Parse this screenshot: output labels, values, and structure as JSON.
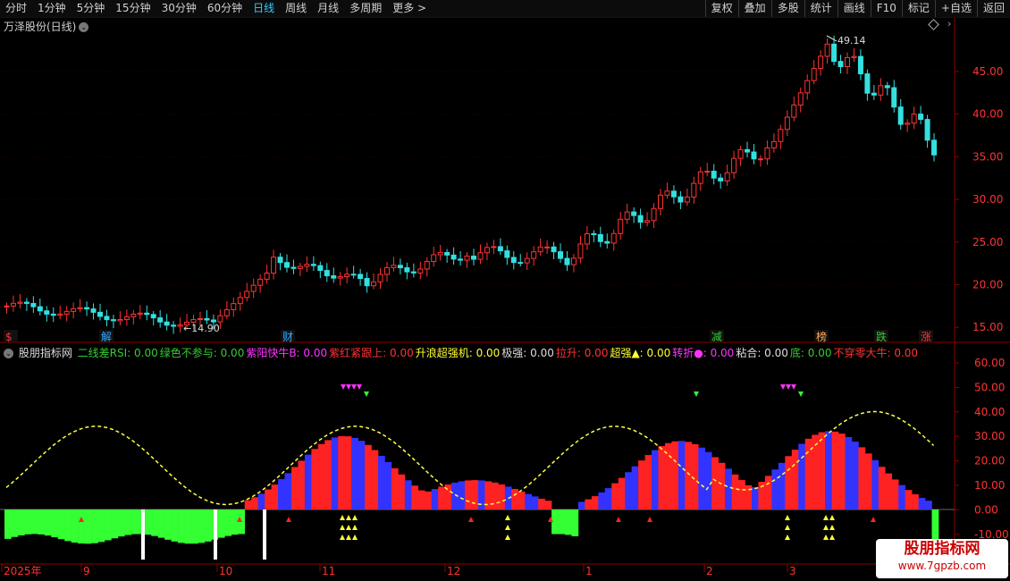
{
  "toolbar": {
    "tabs": [
      "分时",
      "1分钟",
      "5分钟",
      "15分钟",
      "30分钟",
      "60分钟",
      "日线",
      "周线",
      "月线",
      "多周期",
      "更多 >"
    ],
    "active_tab": "日线",
    "right_buttons": [
      "复权",
      "叠加",
      "多股",
      "统计",
      "画线",
      "F10",
      "标记",
      "+自选",
      "返回"
    ]
  },
  "stock": {
    "title": "万泽股份(日线)"
  },
  "price_axis": {
    "labels": [
      "45.00",
      "40.00",
      "35.00",
      "30.00",
      "25.00",
      "20.00",
      "15.00"
    ]
  },
  "annotations": {
    "high": "49.14",
    "low": "14.90"
  },
  "event_markers": [
    {
      "text": "$",
      "color": "#ff3333"
    },
    {
      "text": "解",
      "color": "#33aaff"
    },
    {
      "text": "财",
      "color": "#33aaff"
    },
    {
      "text": "减",
      "color": "#33cc33"
    },
    {
      "text": "榜",
      "color": "#ffaa55"
    },
    {
      "text": "跌",
      "color": "#33cc33"
    },
    {
      "text": "涨",
      "color": "#ff3333"
    }
  ],
  "indicator": {
    "name": "股朋指标网",
    "values": [
      {
        "label": "二线差RSI: 0.00",
        "color": "#33cc33"
      },
      {
        "label": "绿色不参与: 0.00",
        "color": "#33cc33"
      },
      {
        "label": "紫阳快牛B: 0.00",
        "color": "#ff33ff"
      },
      {
        "label": "紫红紧跟上: 0.00",
        "color": "#ff3333"
      },
      {
        "label": "升浪超强机: 0.00",
        "color": "#ffff33"
      },
      {
        "label": "极强: 0.00",
        "color": "#dddddd"
      },
      {
        "label": "拉升: 0.00",
        "color": "#ff3333"
      },
      {
        "label": "超强▲: 0.00",
        "color": "#ffff33"
      },
      {
        "label": "转折●: 0.00",
        "color": "#ff33ff"
      },
      {
        "label": "粘合: 0.00",
        "color": "#dddddd"
      },
      {
        "label": "底: 0.00",
        "color": "#33cc33"
      },
      {
        "label": "不穿零大牛: 0.00",
        "color": "#ff3333"
      }
    ]
  },
  "indicator_axis": {
    "labels": [
      "60.00",
      "50.00",
      "40.00",
      "30.00",
      "20.00",
      "10.00",
      "0.00",
      "-10.00"
    ]
  },
  "time_axis": {
    "labels": [
      "2025年",
      "9",
      "10",
      "11",
      "12",
      "1",
      "2",
      "3"
    ]
  },
  "watermark": {
    "title": "股朋指标网",
    "url": "www.7gpzb.com"
  },
  "colors": {
    "up": "#ff3333",
    "down": "#33e0e0",
    "grid": "#8b0000"
  }
}
